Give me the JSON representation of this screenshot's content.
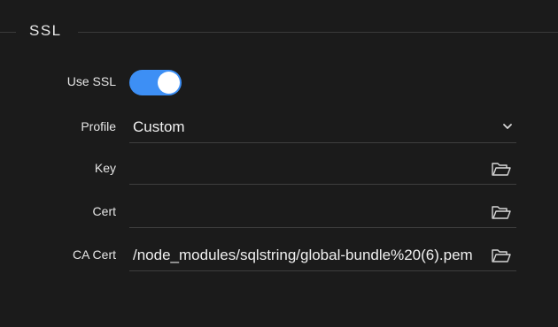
{
  "section": {
    "title": "SSL"
  },
  "use_ssl": {
    "label": "Use SSL",
    "enabled": true,
    "accent_color": "#3d8ff5"
  },
  "profile": {
    "label": "Profile",
    "value": "Custom",
    "icon": "chevron-down-icon"
  },
  "key": {
    "label": "Key",
    "value": "",
    "icon": "folder-open-icon"
  },
  "cert": {
    "label": "Cert",
    "value": "",
    "icon": "folder-open-icon"
  },
  "ca_cert": {
    "label": "CA Cert",
    "value": "/node_modules/sqlstring/global-bundle%20(6).pem",
    "icon": "folder-open-icon"
  }
}
